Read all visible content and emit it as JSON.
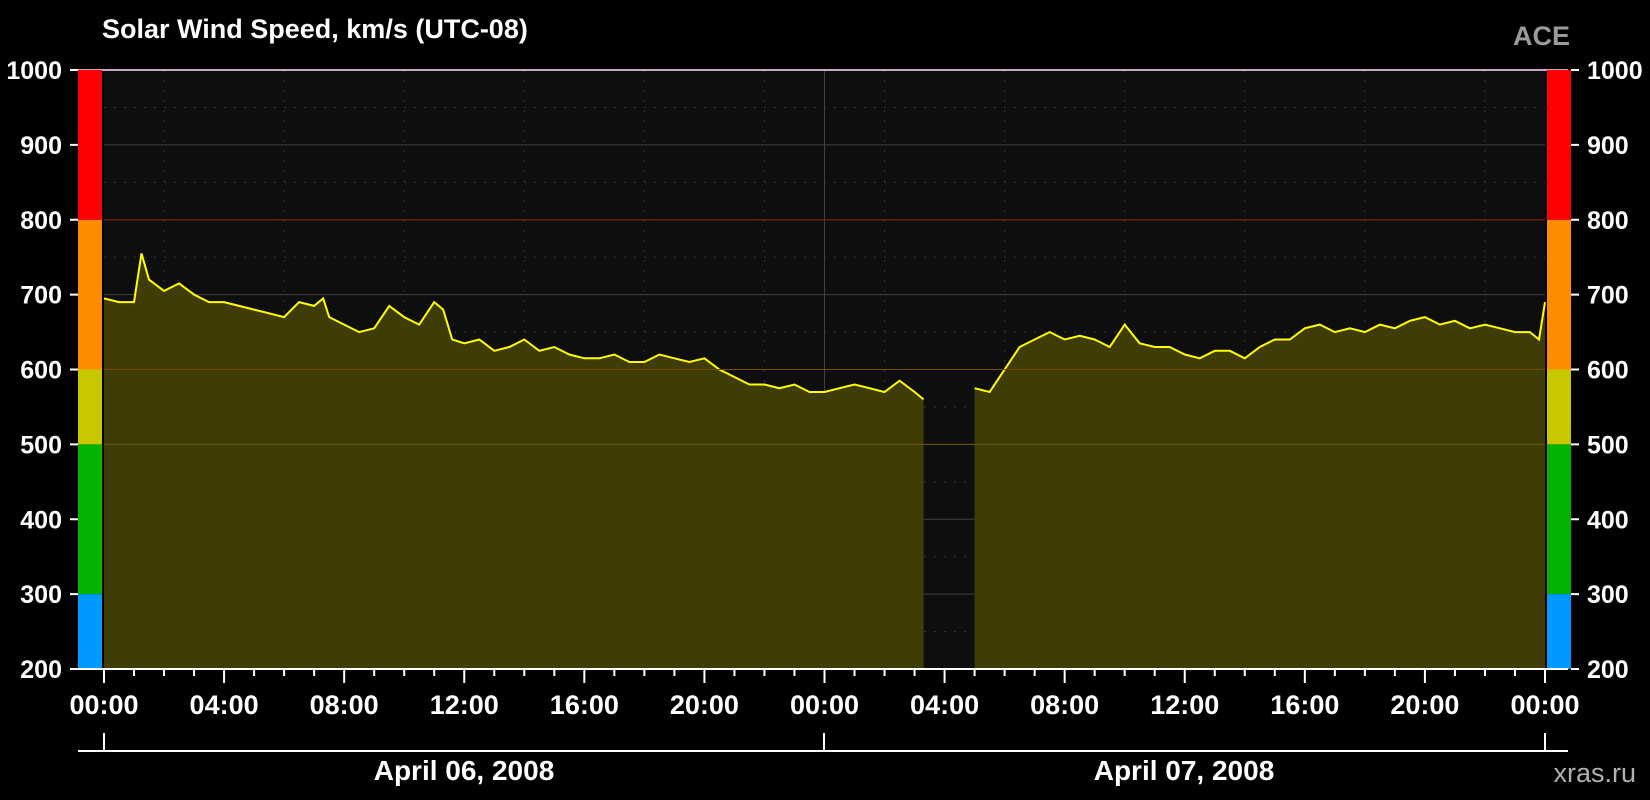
{
  "chart_data": {
    "type": "area",
    "title": "Solar Wind Speed, km/s (UTC-08)",
    "source_label": "ACE",
    "credit": "xras.ru",
    "ylim": [
      200,
      1000
    ],
    "y_ticks": [
      "200",
      "300",
      "400",
      "500",
      "600",
      "700",
      "800",
      "900",
      "1000"
    ],
    "x_tick_labels": [
      "00:00",
      "04:00",
      "08:00",
      "12:00",
      "16:00",
      "20:00",
      "00:00",
      "04:00",
      "08:00",
      "12:00",
      "16:00",
      "20:00",
      "00:00"
    ],
    "date_labels": [
      "April 06, 2008",
      "April 07, 2008"
    ],
    "xlim_hours": [
      0,
      48
    ],
    "x_unit": "hours",
    "threshold_lines": [
      500,
      600,
      800
    ],
    "scale_bands": [
      {
        "from": 200,
        "to": 300,
        "color": "#0099ff"
      },
      {
        "from": 300,
        "to": 500,
        "color": "#00b400"
      },
      {
        "from": 500,
        "to": 600,
        "color": "#c8c800"
      },
      {
        "from": 600,
        "to": 800,
        "color": "#ff8c00"
      },
      {
        "from": 800,
        "to": 1000,
        "color": "#ff0000"
      }
    ],
    "line_color": "#ffff00",
    "fill_color": "#3f3c06",
    "grid": true,
    "series": [
      {
        "x": [
          0,
          0.5,
          1,
          1.25,
          1.5,
          2,
          2.5,
          3,
          3.5,
          4,
          4.5,
          5,
          5.5,
          6,
          6.5,
          7,
          7.3,
          7.5,
          8,
          8.5,
          9,
          9.5,
          10,
          10.5,
          11,
          11.3,
          11.6,
          12,
          12.5,
          13,
          13.5,
          14,
          14.5,
          15,
          15.5,
          16,
          16.5,
          17,
          17.5,
          18,
          18.5,
          19,
          19.5,
          20,
          20.5,
          21,
          21.5,
          22,
          22.5,
          23,
          23.5,
          24,
          24.5,
          25,
          25.5,
          26,
          26.5,
          27,
          27.3
        ],
        "y": [
          695,
          690,
          690,
          755,
          720,
          705,
          715,
          700,
          690,
          690,
          685,
          680,
          675,
          670,
          690,
          685,
          695,
          670,
          660,
          650,
          655,
          685,
          670,
          660,
          690,
          680,
          640,
          635,
          640,
          625,
          630,
          640,
          625,
          630,
          620,
          615,
          615,
          620,
          610,
          610,
          620,
          615,
          610,
          615,
          600,
          590,
          580,
          580,
          575,
          580,
          570,
          570,
          575,
          580,
          575,
          570,
          585,
          570,
          560
        ]
      },
      {
        "x": [
          29,
          29.5,
          30,
          30.5,
          31,
          31.5,
          32,
          32.5,
          33,
          33.5,
          34,
          34.5,
          35,
          35.5,
          36,
          36.5,
          37,
          37.5,
          38,
          38.5,
          39,
          39.5,
          40,
          40.5,
          41,
          41.5,
          42,
          42.5,
          43,
          43.5,
          44,
          44.5,
          45,
          45.5,
          46,
          46.5,
          47,
          47.5,
          47.8,
          48
        ],
        "y": [
          575,
          570,
          600,
          630,
          640,
          650,
          640,
          645,
          640,
          630,
          660,
          635,
          630,
          630,
          620,
          615,
          625,
          625,
          615,
          630,
          640,
          640,
          655,
          660,
          650,
          655,
          650,
          660,
          655,
          665,
          670,
          660,
          665,
          655,
          660,
          655,
          650,
          650,
          640,
          690
        ]
      }
    ]
  }
}
